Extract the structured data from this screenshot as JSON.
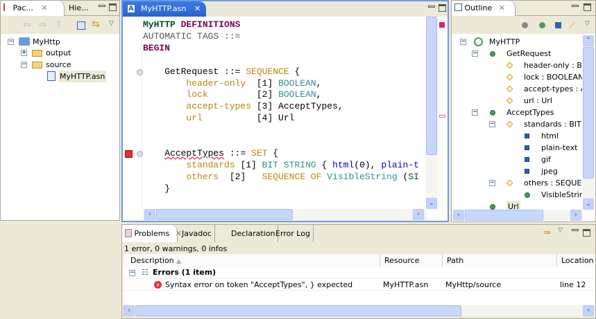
{
  "left_panel": {
    "tabs": [
      {
        "label": "Pac...",
        "icon": "package-explorer-icon"
      },
      {
        "label": "Hie...",
        "icon": ""
      }
    ],
    "toolbar": [
      "back-icon",
      "forward-icon",
      "up-icon",
      "collapse-all-icon",
      "link-with-editor-icon",
      "view-menu-icon"
    ],
    "tree": [
      {
        "label": "MyHttp",
        "level": 0,
        "expanded": true,
        "icon": "asn-project-error-icon"
      },
      {
        "label": "output",
        "level": 1,
        "expanded": false,
        "icon": "folder-icon"
      },
      {
        "label": "source",
        "level": 1,
        "expanded": true,
        "icon": "folder-error-icon"
      },
      {
        "label": "MyHTTP.asn",
        "level": 2,
        "icon": "asn-file-error-icon",
        "selected": true
      }
    ]
  },
  "editor": {
    "tab": "MyHTTP.asn",
    "colors": {
      "keyword": "#7f0055",
      "type": "#2f8f8f",
      "field": "#b8860b",
      "builtin": "#0000c0",
      "text": "#000000",
      "muted": "#555555",
      "green": "#005028"
    },
    "lines": [
      [
        [
          "MyHTTP ",
          "green",
          1
        ],
        [
          "DEFINITIONS",
          "keyword",
          1
        ]
      ],
      [
        [
          "AUTOMATIC TAGS ::=",
          "muted"
        ]
      ],
      [
        [
          "BEGIN",
          "keyword",
          1
        ]
      ],
      [],
      [
        [
          "    GetRequest ::= ",
          "text"
        ],
        [
          "SEQUENCE",
          "field"
        ],
        [
          " {",
          "text"
        ]
      ],
      [
        [
          "        ",
          "text"
        ],
        [
          "header-only",
          "field"
        ],
        [
          "  [1] ",
          "text"
        ],
        [
          "BOOLEAN",
          "type"
        ],
        [
          ",",
          "text"
        ]
      ],
      [
        [
          "        ",
          "text"
        ],
        [
          "lock",
          "field"
        ],
        [
          "         [2] ",
          "text"
        ],
        [
          "BOOLEAN",
          "type"
        ],
        [
          ",",
          "text"
        ]
      ],
      [
        [
          "        ",
          "text"
        ],
        [
          "accept-types",
          "field"
        ],
        [
          " [3] AcceptTypes,",
          "text"
        ]
      ],
      [
        [
          "        ",
          "text"
        ],
        [
          "url",
          "field"
        ],
        [
          "          [4] Url",
          "text"
        ]
      ],
      [],
      [],
      [
        [
          "    ",
          "text"
        ],
        [
          "AcceptTypes",
          "text",
          "err"
        ],
        [
          " ::= ",
          "text"
        ],
        [
          "SET",
          "field"
        ],
        [
          " {",
          "text"
        ]
      ],
      [
        [
          "        ",
          "text"
        ],
        [
          "standards",
          "field"
        ],
        [
          " [1] ",
          "text"
        ],
        [
          "BIT STRING",
          "type"
        ],
        [
          " { ",
          "text"
        ],
        [
          "html",
          "builtin"
        ],
        [
          "(0), ",
          "text"
        ],
        [
          "plain-t",
          "builtin"
        ]
      ],
      [
        [
          "        ",
          "text"
        ],
        [
          "others",
          "field"
        ],
        [
          "  [2]   ",
          "text"
        ],
        [
          "SEQUENCE OF",
          "field"
        ],
        [
          " ",
          "text"
        ],
        [
          "VisibleString",
          "type"
        ],
        [
          " (",
          "text"
        ],
        [
          "SI",
          "green"
        ]
      ],
      [
        [
          "    }",
          "text"
        ]
      ]
    ]
  },
  "outline": {
    "tab": "Outline",
    "toolbar": [
      "hide-fields-icon",
      "hide-types-icon",
      "hide-values-icon",
      "sort-icon",
      "view-menu-icon"
    ],
    "tree": [
      {
        "label": "MyHTTP",
        "level": 0,
        "kind": "module"
      },
      {
        "label": "GetRequest",
        "level": 1,
        "kind": "type"
      },
      {
        "label": "header-only : BC",
        "level": 2,
        "kind": "field"
      },
      {
        "label": "lock : BOOLEAN",
        "level": 2,
        "kind": "field"
      },
      {
        "label": "accept-types : A",
        "level": 2,
        "kind": "field"
      },
      {
        "label": "url : Url",
        "level": 2,
        "kind": "field"
      },
      {
        "label": "AcceptTypes",
        "level": 1,
        "kind": "type"
      },
      {
        "label": "standards : BIT S",
        "level": 2,
        "kind": "field"
      },
      {
        "label": "html",
        "level": 3,
        "kind": "value"
      },
      {
        "label": "plain-text",
        "level": 3,
        "kind": "value"
      },
      {
        "label": "gif",
        "level": 3,
        "kind": "value"
      },
      {
        "label": "jpeg",
        "level": 3,
        "kind": "value"
      },
      {
        "label": "others : SEQUEN",
        "level": 2,
        "kind": "field"
      },
      {
        "label": "VisibleString",
        "level": 3,
        "kind": "type"
      },
      {
        "label": "Url",
        "level": 1,
        "kind": "type",
        "selected": true
      }
    ]
  },
  "bottom": {
    "tabs": [
      "Problems",
      "Javadoc",
      "Declaration",
      "Error Log"
    ],
    "status": "1 error, 0 warnings, 0 infos",
    "columns": [
      "Description",
      "Resource",
      "Path",
      "Location"
    ],
    "group": "Errors (1 item)",
    "rows": [
      {
        "description": "Syntax error on token \"AcceptTypes\", } expected",
        "resource": "MyHTTP.asn",
        "path": "MyHttp/source",
        "location": "line 12"
      }
    ]
  }
}
